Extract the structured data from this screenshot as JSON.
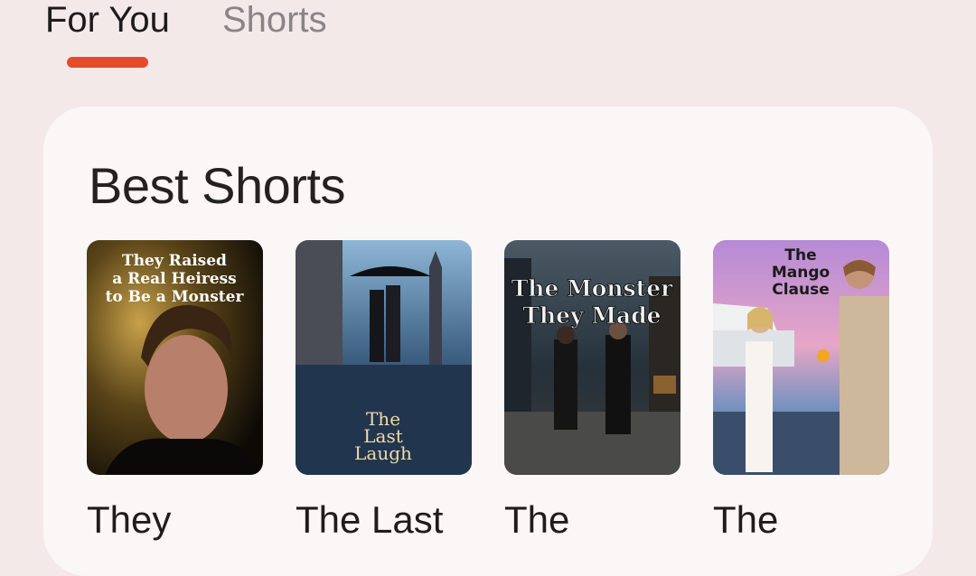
{
  "tabs": [
    {
      "label": "For You",
      "active": true
    },
    {
      "label": "Shorts",
      "active": false
    }
  ],
  "accent_color": "#e8492b",
  "section": {
    "title": "Best Shorts"
  },
  "books": [
    {
      "title": "They",
      "cover_lines": [
        "They Raised",
        "a Real Heiress",
        "to Be a Monster"
      ],
      "cover_theme": "portrait-dark-gold"
    },
    {
      "title": "The Last",
      "cover_lines": [
        "The",
        "Last",
        "Laugh"
      ],
      "cover_theme": "umbrella-city-rain"
    },
    {
      "title": "The",
      "cover_lines": [
        "The Monster",
        "They Made"
      ],
      "cover_theme": "rainy-street-couple"
    },
    {
      "title": "The",
      "cover_lines": [
        "The",
        "Mango",
        "Clause"
      ],
      "cover_theme": "yacht-sunset-couple"
    }
  ]
}
